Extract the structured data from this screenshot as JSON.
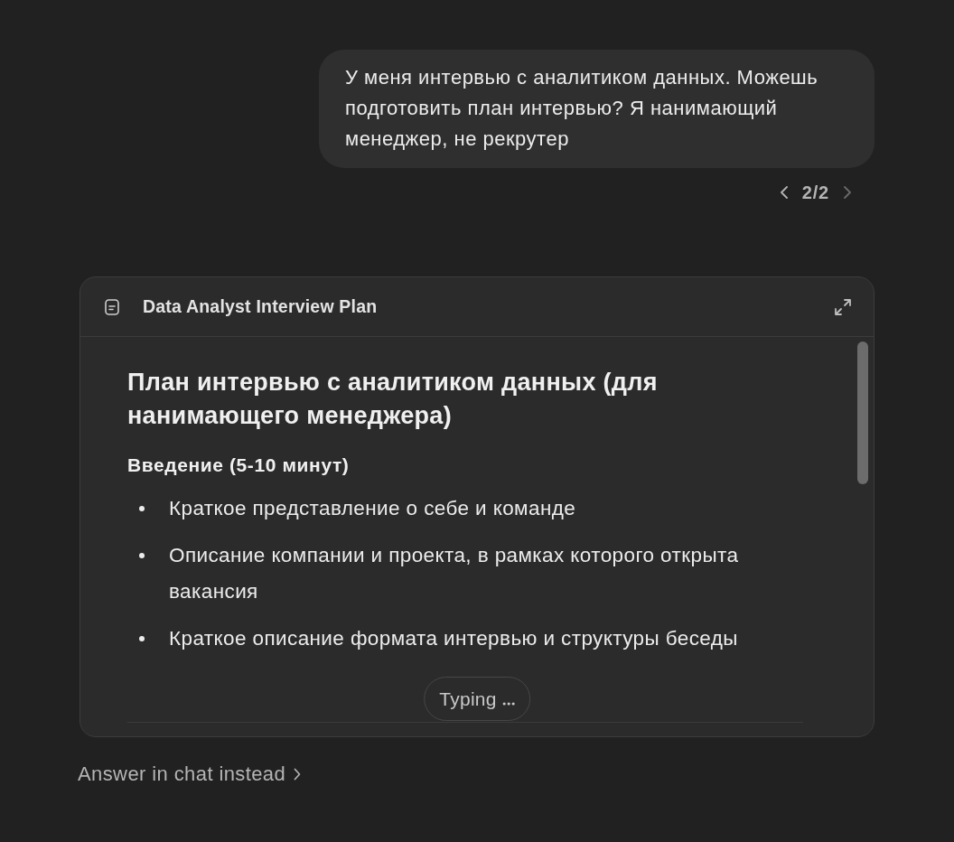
{
  "user_message": {
    "text": "У меня интервью с аналитиком данных. Можешь подготовить план интервью? Я нанимающий менеджер, не рекрутер"
  },
  "pager": {
    "label": "2/2",
    "previous": {
      "disabled": false
    },
    "next": {
      "disabled": true
    }
  },
  "artifact": {
    "title": "Data Analyst Interview Plan",
    "document": {
      "title": "План интервью с аналитиком данных (для нанимающего менеджера)",
      "sections": [
        {
          "heading": "Введение (5-10 минут)",
          "bullets": [
            "Краткое представление о себе и команде",
            "Описание компании и проекта, в рамках которого открыта вакансия",
            "Краткое описание формата интервью и структуры беседы"
          ]
        }
      ]
    },
    "status": {
      "label": "Typing"
    }
  },
  "footer": {
    "link": "Answer in chat instead"
  }
}
